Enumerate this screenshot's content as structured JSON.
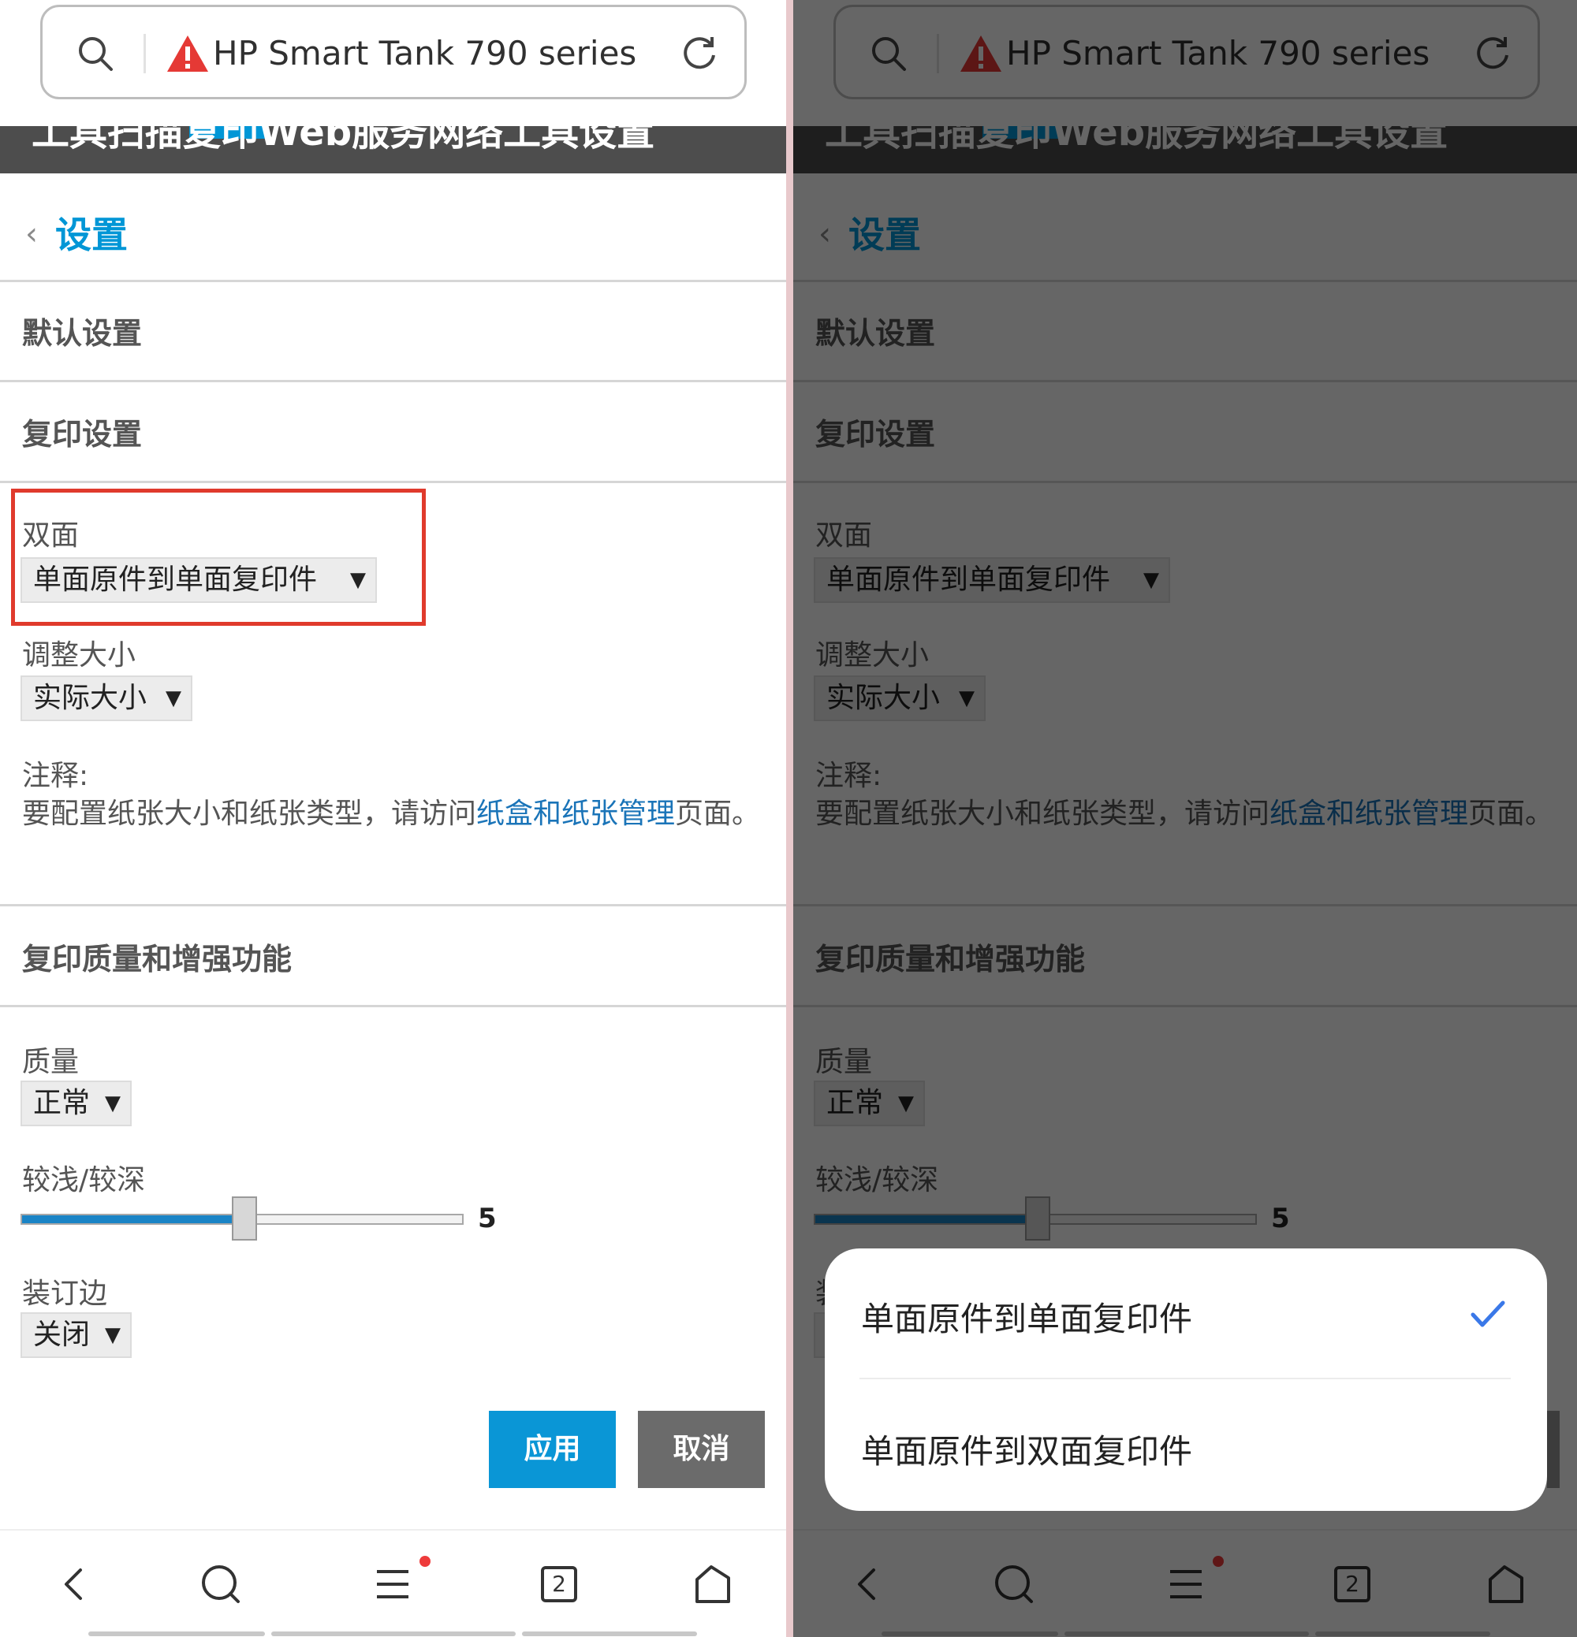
{
  "url_bar": {
    "title": "HP Smart Tank 790 series"
  },
  "header_band": {
    "partial_text": "工具扫描复印Web服务网络工具设置"
  },
  "nav": {
    "back_label": "设置"
  },
  "sections": {
    "default_settings": "默认设置",
    "copy_settings": "复印设置",
    "copy_quality": "复印质量和增强功能"
  },
  "duplex": {
    "label": "双面",
    "value": "单面原件到单面复印件",
    "arrow": "▼"
  },
  "resize": {
    "label": "调整大小",
    "value": "实际大小",
    "arrow": "▼"
  },
  "note": {
    "label": "注释:",
    "text_before": "要配置纸张大小和纸张类型，请访问",
    "link": "纸盒和纸张管理",
    "text_after": "页面。"
  },
  "quality": {
    "label": "质量",
    "value": "正常",
    "arrow": "▼"
  },
  "darkness": {
    "label": "较浅/较深",
    "value": "5",
    "fraction": 0.5
  },
  "binding": {
    "label": "装订边",
    "value": "关闭",
    "arrow": "▼"
  },
  "buttons": {
    "apply": "应用",
    "cancel": "取消"
  },
  "bottom_nav": {
    "tab_count": "2"
  },
  "picker": {
    "options": [
      "单面原件到单面复印件",
      "单面原件到双面复印件"
    ],
    "selected_index": 0
  },
  "colors": {
    "accent": "#0096d6",
    "link": "#1a74b8",
    "highlight": "#e03a2c",
    "warning": "#e53935"
  },
  "icons": [
    "search-icon",
    "warning-icon",
    "reload-icon",
    "chevron-left-icon",
    "menu-icon",
    "tabs-icon",
    "home-icon",
    "check-icon"
  ]
}
